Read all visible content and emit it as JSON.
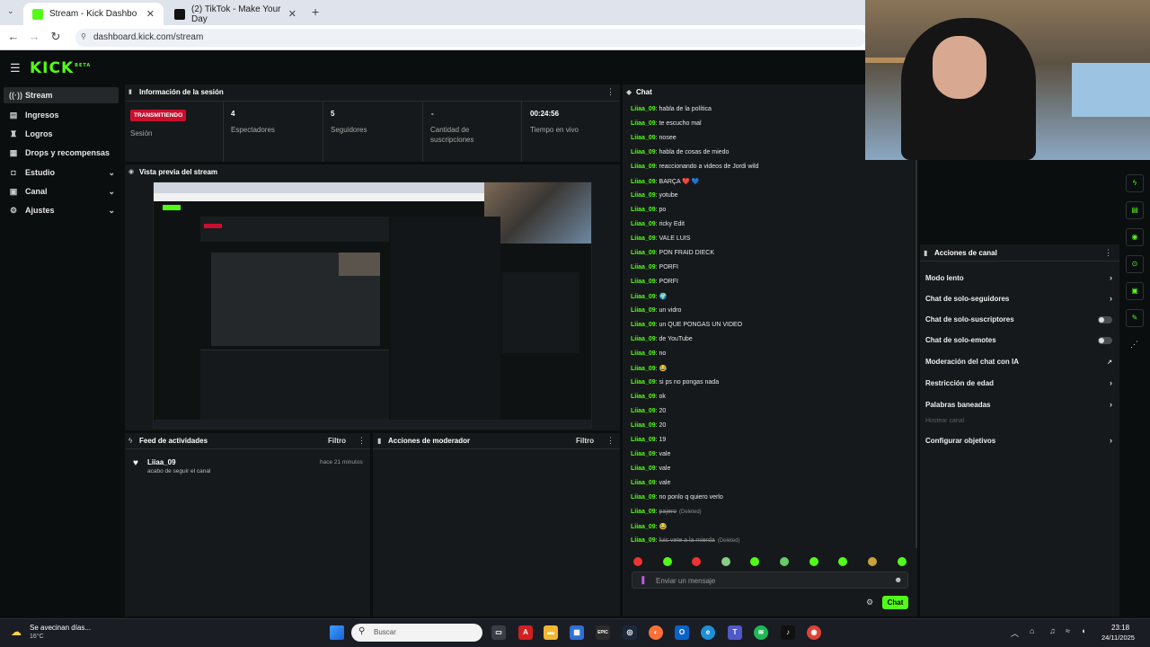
{
  "browser": {
    "tabs": [
      {
        "title": "Stream - Kick Dashbo",
        "active": true
      },
      {
        "title": "(2) TikTok - Make Your Day",
        "active": false
      }
    ],
    "url": "dashboard.kick.com/stream"
  },
  "header": {
    "logo": "KICK",
    "logo_badge": "BETA"
  },
  "sidebar": {
    "items": [
      {
        "label": "Stream",
        "icon": "stream-icon",
        "active": true
      },
      {
        "label": "Ingresos",
        "icon": "money-icon"
      },
      {
        "label": "Logros",
        "icon": "trophy-icon"
      },
      {
        "label": "Drops y recompensas",
        "icon": "gift-icon"
      },
      {
        "label": "Estudio",
        "icon": "studio-icon",
        "expandable": true
      },
      {
        "label": "Canal",
        "icon": "channel-icon",
        "expandable": true
      },
      {
        "label": "Ajustes",
        "icon": "gear-icon",
        "expandable": true
      }
    ]
  },
  "session": {
    "title": "Información de la sesión",
    "status_badge": "TRANSMITIENDO",
    "status_label": "Sesión",
    "stats": [
      {
        "value": "4",
        "label": "Espectadores"
      },
      {
        "value": "5",
        "label": "Seguidores"
      },
      {
        "value": "-",
        "label": "Cantidad de suscripciones"
      },
      {
        "value": "00:24:56",
        "label": "Tiempo en vivo"
      }
    ]
  },
  "preview": {
    "title": "Vista previa del stream"
  },
  "activity": {
    "title": "Feed de actividades",
    "filter": "Filtro",
    "items": [
      {
        "user": "Liiaa_09",
        "text": "acabo de seguir el canal",
        "time": "hace 21 minutos"
      }
    ]
  },
  "moderator": {
    "title": "Acciones de moderador",
    "filter": "Filtro"
  },
  "chat": {
    "title": "Chat",
    "messages": [
      {
        "user": "Liiaa_09",
        "text": "habla de la política"
      },
      {
        "user": "Liiaa_09",
        "text": "te escucho mal"
      },
      {
        "user": "Liiaa_09",
        "text": "nosee"
      },
      {
        "user": "Liiaa_09",
        "text": "habla de cosas de miedo"
      },
      {
        "user": "Liiaa_09",
        "text": "reaccionando a videos de Jordi wild"
      },
      {
        "user": "Liiaa_09",
        "text": "BARÇA ❤️ 💙"
      },
      {
        "user": "Liiaa_09",
        "text": "yotube"
      },
      {
        "user": "Liiaa_09",
        "text": "po"
      },
      {
        "user": "Liiaa_09",
        "text": "ricky Edit"
      },
      {
        "user": "Liiaa_09",
        "text": "VALE LUIS"
      },
      {
        "user": "Liiaa_09",
        "text": "PON FRAID DIECK"
      },
      {
        "user": "Liiaa_09",
        "text": "PORFI"
      },
      {
        "user": "Liiaa_09",
        "text": "PORFI"
      },
      {
        "user": "Liiaa_09",
        "text": "🌍"
      },
      {
        "user": "Liiaa_09",
        "text": "un vidro"
      },
      {
        "user": "Liiaa_09",
        "text": "un QUE PONGAS UN VIDEO"
      },
      {
        "user": "Liiaa_09",
        "text": "de YouTube"
      },
      {
        "user": "Liiaa_09",
        "text": "no"
      },
      {
        "user": "Liiaa_09",
        "text": "😂"
      },
      {
        "user": "Liiaa_09",
        "text": "si ps no pongas nada"
      },
      {
        "user": "Liiaa_09",
        "text": "ok"
      },
      {
        "user": "Liiaa_09",
        "text": "20"
      },
      {
        "user": "Liiaa_09",
        "text": "20"
      },
      {
        "user": "Liiaa_09",
        "text": "19"
      },
      {
        "user": "Liiaa_09",
        "text": "vale"
      },
      {
        "user": "Liiaa_09",
        "text": "vale"
      },
      {
        "user": "Liiaa_09",
        "text": "vale"
      },
      {
        "user": "Liiaa_09",
        "text": "no ponlo q quiero verlo"
      },
      {
        "user": "Liiaa_09",
        "text": "pajero",
        "deleted": "(Deleted)"
      },
      {
        "user": "Liiaa_09",
        "text": "😂"
      },
      {
        "user": "Liiaa_09",
        "text": "luis vete a la mierda",
        "deleted": "(Deleted)"
      }
    ],
    "input_placeholder": "Enviar un mensaje",
    "send_label": "Chat"
  },
  "channel_actions": {
    "title": "Acciones de canal",
    "items": [
      {
        "label": "Modo lento",
        "control": "chevron"
      },
      {
        "label": "Chat de solo-seguidores",
        "control": "chevron"
      },
      {
        "label": "Chat de solo-suscriptores",
        "control": "toggle"
      },
      {
        "label": "Chat de solo-emotes",
        "control": "toggle"
      },
      {
        "label": "Moderación del chat con IA",
        "control": "external"
      },
      {
        "label": "Restricción de edad",
        "control": "chevron"
      },
      {
        "label": "Palabras baneadas",
        "control": "chevron"
      },
      {
        "label": "Hostear canal",
        "control": "none",
        "disabled": true
      },
      {
        "label": "Configurar objetivos",
        "control": "chevron"
      }
    ]
  },
  "taskbar": {
    "weather_text": "Se avecinan días...",
    "weather_temp": "16°C",
    "search_placeholder": "Buscar",
    "time": "23:18",
    "date": "24/11/2025"
  },
  "colors": {
    "accent": "#53fc18",
    "live_badge": "#c8102e"
  }
}
